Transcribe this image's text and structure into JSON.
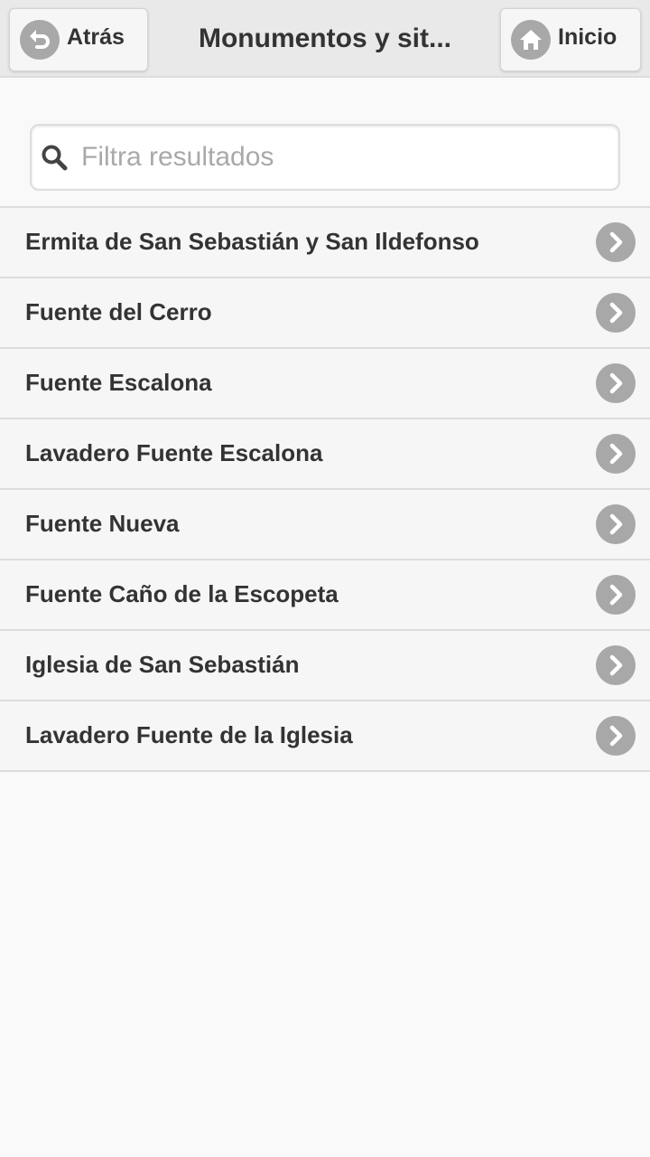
{
  "header": {
    "back_label": "Atrás",
    "title": "Monumentos y sit...",
    "home_label": "Inicio",
    "back_icon": "undo-arrow-icon",
    "home_icon": "home-icon"
  },
  "search": {
    "placeholder": "Filtra resultados",
    "value": "",
    "icon": "search-icon"
  },
  "list": {
    "items": [
      {
        "label": "Ermita de San Sebastián y San Ildefonso"
      },
      {
        "label": "Fuente del Cerro"
      },
      {
        "label": "Fuente Escalona"
      },
      {
        "label": "Lavadero Fuente Escalona"
      },
      {
        "label": "Fuente Nueva"
      },
      {
        "label": "Fuente Caño de la Escopeta"
      },
      {
        "label": "Iglesia de San Sebastián"
      },
      {
        "label": "Lavadero Fuente de la Iglesia"
      }
    ],
    "item_icon": "chevron-right-icon"
  },
  "colors": {
    "header_bg": "#e9e9e9",
    "page_bg": "#f9f9f9",
    "icon_disc": "#a8a8a8",
    "text": "#333333",
    "placeholder": "#a9a9a9"
  }
}
